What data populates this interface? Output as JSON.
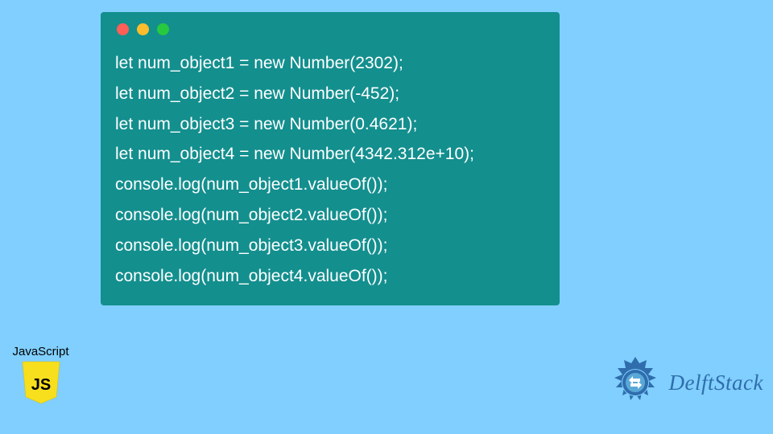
{
  "code": {
    "lines": [
      "let num_object1 = new Number(2302);",
      "let num_object2 = new Number(-452);",
      "let num_object3 = new Number(0.4621);",
      "let num_object4 = new Number(4342.312e+10);",
      "console.log(num_object1.valueOf());",
      "console.log(num_object2.valueOf());",
      "console.log(num_object3.valueOf());",
      "console.log(num_object4.valueOf());"
    ]
  },
  "jsBadge": {
    "label": "JavaScript",
    "iconText": "JS"
  },
  "brand": {
    "name": "DelftStack"
  },
  "colors": {
    "pageBg": "#80cffe",
    "windowBg": "#138f8e",
    "jsYellow": "#f7df1e",
    "brandBlue": "#2f6dad"
  }
}
